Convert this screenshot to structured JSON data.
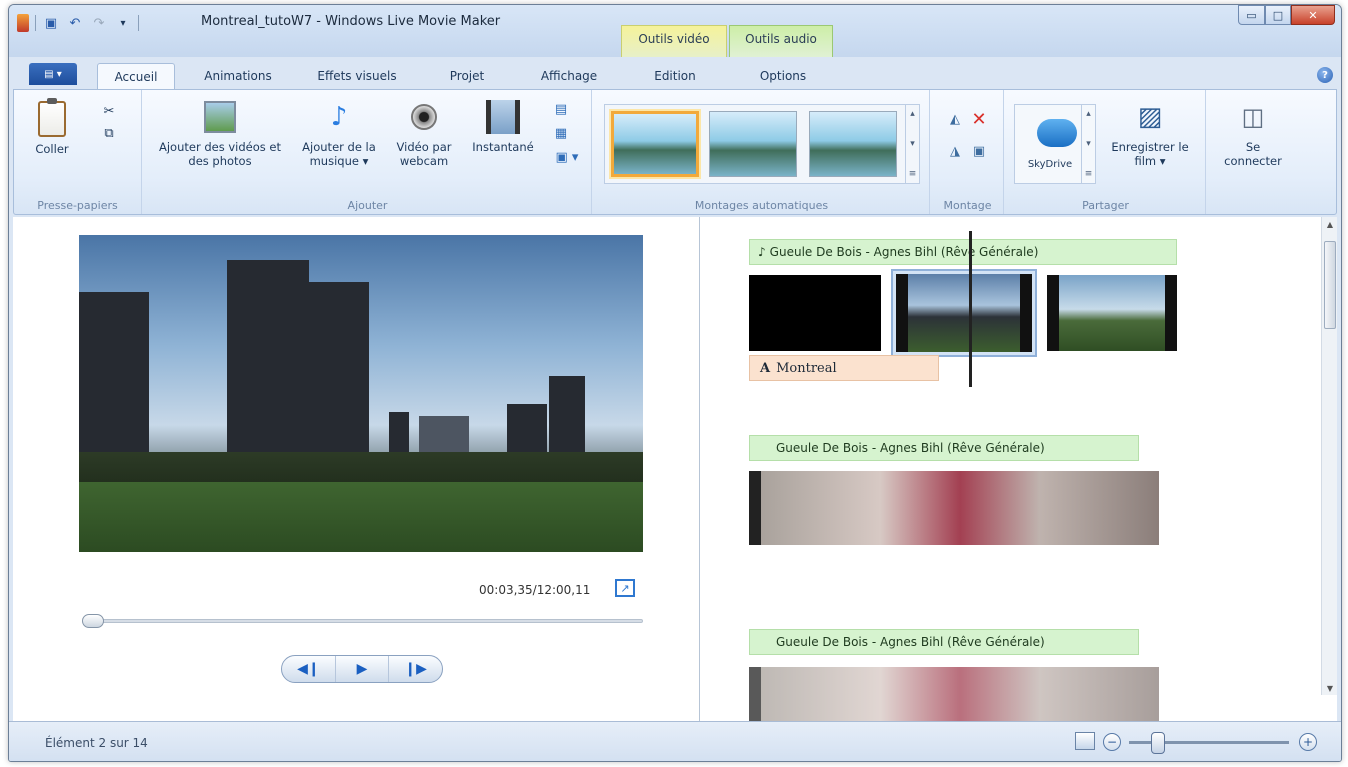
{
  "window": {
    "title": "Montreal_tutoW7 - Windows Live Movie Maker",
    "contextual_tabs": {
      "video": "Outils vidéo",
      "audio": "Outils audio"
    }
  },
  "tabs": [
    "Accueil",
    "Animations",
    "Effets visuels",
    "Projet",
    "Affichage",
    "Edition",
    "Options"
  ],
  "ribbon": {
    "clipboard": {
      "paste": "Coller",
      "group": "Presse-papiers"
    },
    "add": {
      "videos": "Ajouter des vidéos et des photos",
      "music": "Ajouter de la musique ▾",
      "webcam": "Vidéo par webcam",
      "snapshot": "Instantané",
      "group": "Ajouter"
    },
    "automovie": {
      "group": "Montages automatiques"
    },
    "editing": {
      "group": "Montage"
    },
    "share": {
      "skydrive": "SkyDrive",
      "save_movie": "Enregistrer le film ▾",
      "group": "Partager"
    },
    "signin": {
      "label": "Se connecter"
    }
  },
  "preview": {
    "time": "00:03,35/12:00,11"
  },
  "timeline": {
    "music_1": "Gueule De Bois - Agnes Bihl (Rêve Générale)",
    "caption": "Montreal",
    "music_2": "Gueule De Bois - Agnes Bihl (Rêve Générale)",
    "music_3": "Gueule De Bois - Agnes Bihl (Rêve Générale)"
  },
  "status": {
    "item": "Élément 2 sur 14"
  },
  "colors": {
    "accent": "#2b62b5",
    "video_tools": "#f5f29a",
    "audio_tools": "#cdeea7",
    "selected_thumb": "#f2a93b"
  }
}
